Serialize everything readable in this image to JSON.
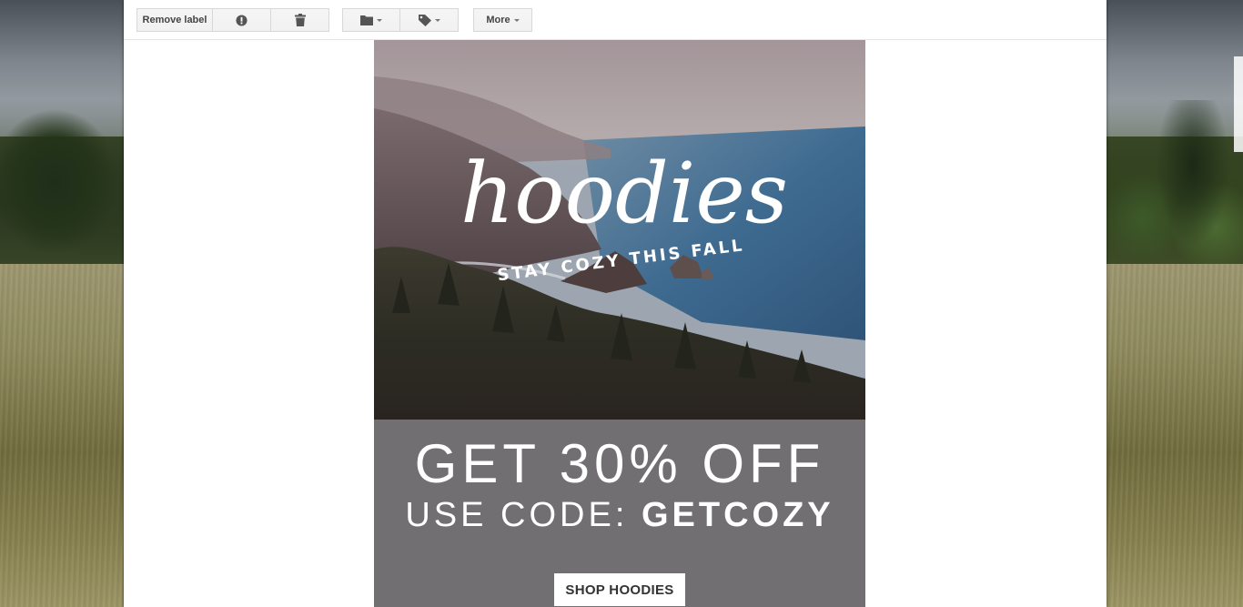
{
  "toolbar": {
    "remove_label": "Remove label",
    "report_spam_icon": "exclamation-circle-icon",
    "delete_icon": "trash-icon",
    "move_icon": "folder-icon",
    "labels_icon": "tag-icon",
    "more_label": "More"
  },
  "email": {
    "hero": {
      "script_title": "hoodies",
      "tagline": "STAY COZY THIS FALL"
    },
    "offer": {
      "headline": "GET 30% OFF",
      "code_prefix": "USE CODE: ",
      "code": "GETCOZY"
    },
    "cta_label": "SHOP HOODIES"
  },
  "colors": {
    "promo_background": "#716f72",
    "button_background": "#ffffff"
  }
}
